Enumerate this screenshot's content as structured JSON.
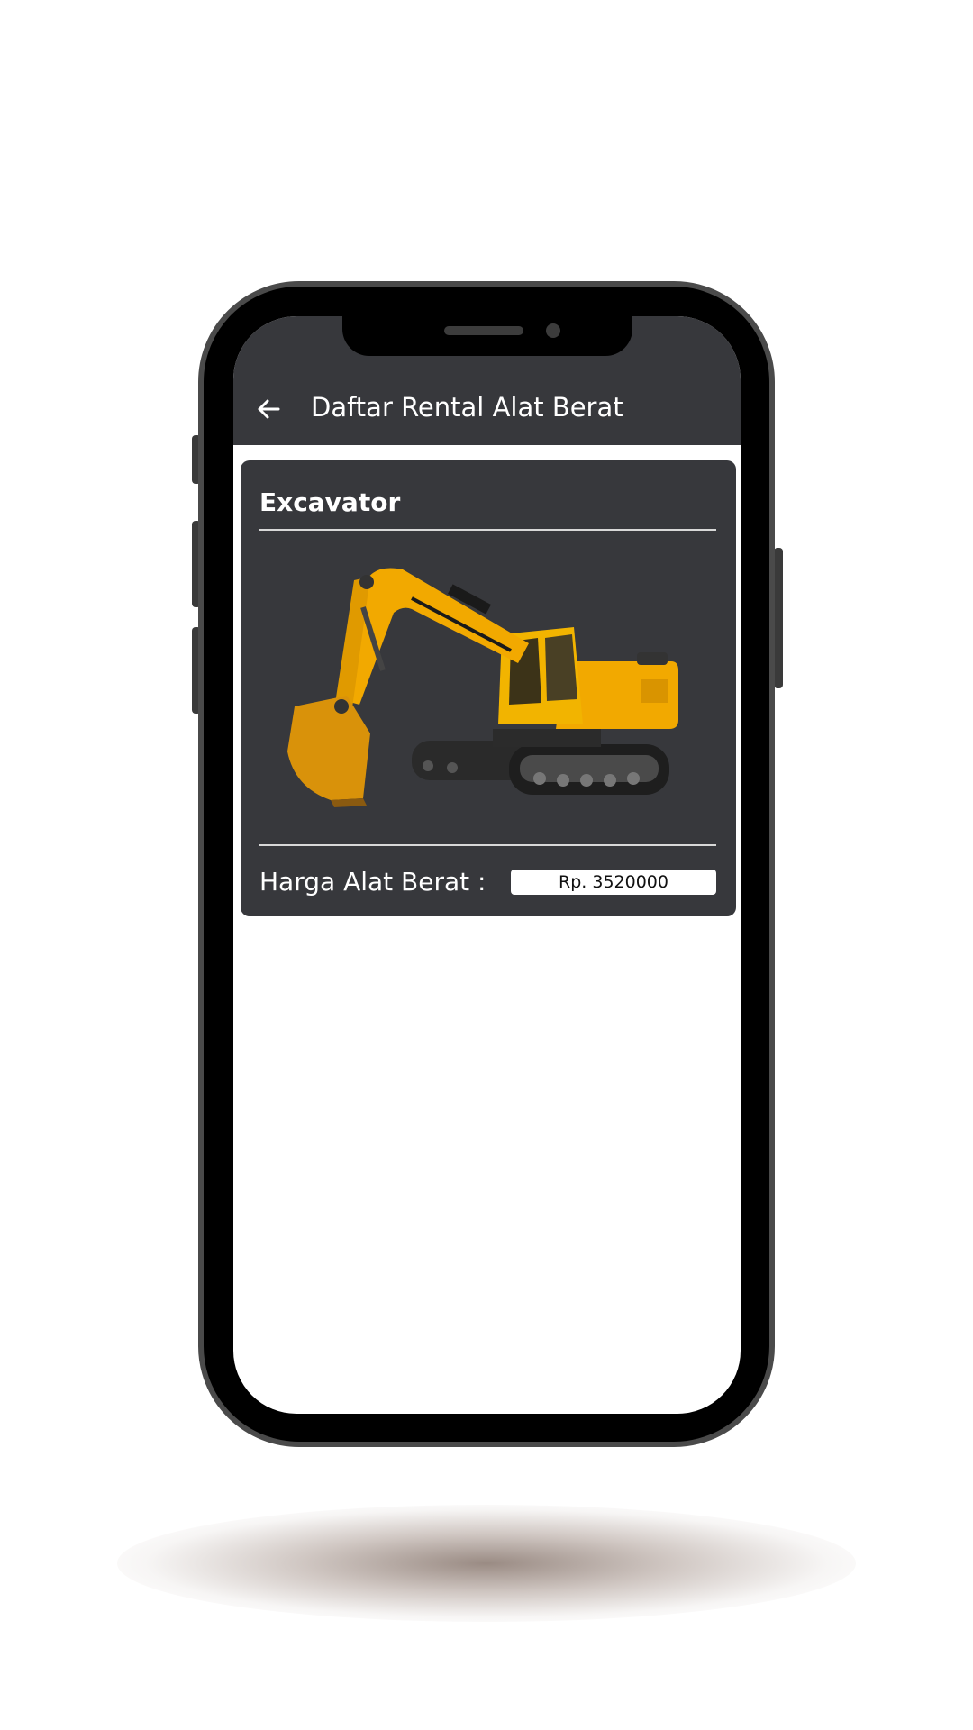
{
  "appbar": {
    "title": "Daftar Rental Alat Berat",
    "back_icon": "arrow-left-icon"
  },
  "card": {
    "title": "Excavator",
    "image": "excavator-image",
    "price_label": "Harga Alat Berat :",
    "price_value": "Rp. 3520000"
  },
  "colors": {
    "appbar_bg": "#37383c",
    "card_bg": "#37383c",
    "text": "#ffffff",
    "phone_frame": "#4a4a4a",
    "machine_yellow": "#f2a900"
  }
}
